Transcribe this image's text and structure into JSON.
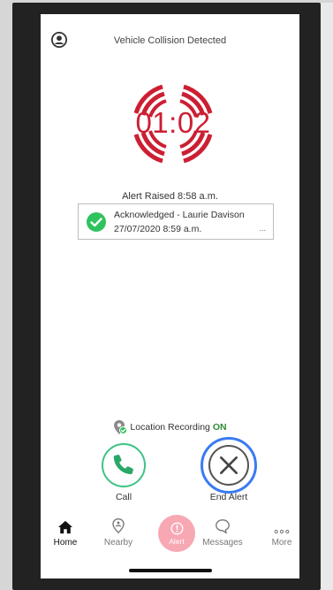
{
  "header": {
    "title": "Vehicle Collision Detected",
    "avatar_icon": "user-circle-icon"
  },
  "timer": {
    "display": "01:02",
    "color": "#cc1f33"
  },
  "alert": {
    "raised_text": "Alert Raised 8:58 a.m."
  },
  "acknowledgement": {
    "line1": "Acknowledged - Laurie Davison",
    "line2": "27/07/2020 8:59 a.m.",
    "more": "...",
    "icon": "check-circle-icon",
    "color": "#2ec35e"
  },
  "location": {
    "label": "Location Recording",
    "status": "ON",
    "status_color": "#2e8b36",
    "icon": "location-pin-check-icon"
  },
  "actions": {
    "call_label": "Call",
    "end_label": "End Alert",
    "call_color": "#3ec285",
    "end_focus_color": "#3a7bf2"
  },
  "nav": {
    "items": [
      {
        "label": "Home",
        "icon": "home-icon",
        "active": true
      },
      {
        "label": "Nearby",
        "icon": "nearby-pin-icon",
        "active": false
      },
      {
        "label": "Alert",
        "icon": "alert-icon",
        "active": false
      },
      {
        "label": "Messages",
        "icon": "message-bubble-icon",
        "active": false
      },
      {
        "label": "More",
        "icon": "more-dots-icon",
        "active": false
      }
    ],
    "alert_color": "#f7a8b3"
  }
}
